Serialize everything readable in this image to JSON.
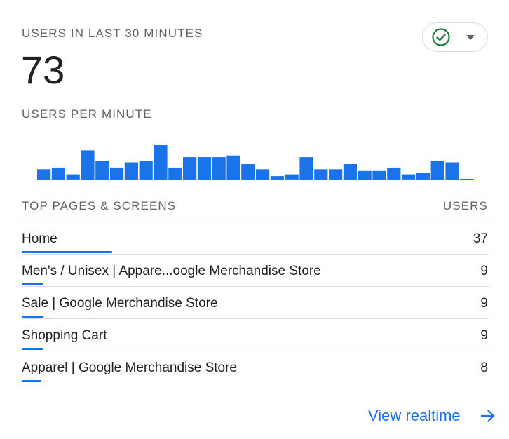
{
  "header": {
    "title": "USERS IN LAST 30 MINUTES",
    "total_users": "73",
    "subtitle": "USERS PER MINUTE",
    "status_icon": "check-circle-icon",
    "dropdown_icon": "caret-down-icon"
  },
  "chart_data": {
    "type": "bar",
    "title": "",
    "xlabel": "",
    "ylabel": "",
    "values": [
      3,
      3.5,
      1.5,
      8.5,
      5.5,
      3.5,
      5,
      5.5,
      10,
      3.5,
      6.5,
      6.5,
      6.5,
      7,
      4.5,
      3,
      1,
      1.5,
      6.5,
      3,
      3,
      4.5,
      2.5,
      2.5,
      3.5,
      1.5,
      2,
      5.5,
      5,
      0.2
    ],
    "color": "#1a73e8",
    "grid": false,
    "ylim": [
      0,
      10
    ]
  },
  "table": {
    "header_left": "TOP PAGES & SCREENS",
    "header_right": "USERS",
    "max_value": 37,
    "rows": [
      {
        "name": "Home",
        "value": "37",
        "fraction": 1.0
      },
      {
        "name": "Men's / Unisex | Appare...oogle Merchandise Store",
        "value": "9",
        "fraction": 0.243
      },
      {
        "name": "Sale | Google Merchandise Store",
        "value": "9",
        "fraction": 0.243
      },
      {
        "name": "Shopping Cart",
        "value": "9",
        "fraction": 0.243
      },
      {
        "name": "Apparel | Google Merchandise Store",
        "value": "8",
        "fraction": 0.216
      }
    ]
  },
  "footer": {
    "link_label": "View realtime",
    "link_icon": "arrow-right-icon"
  },
  "colors": {
    "accent": "#1a73e8",
    "status_green": "#188038"
  }
}
